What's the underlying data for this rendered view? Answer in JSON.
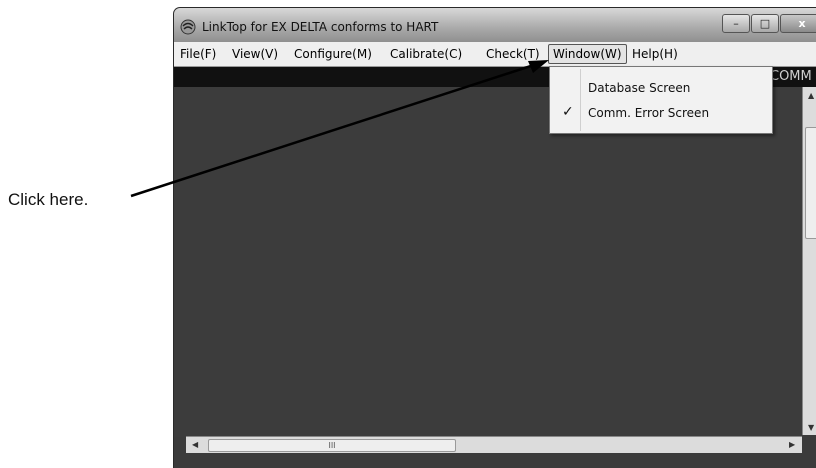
{
  "annotation": {
    "text": "Click here."
  },
  "window": {
    "title": "LinkTop for EX DELTA conforms to HART",
    "controls": {
      "minimize": "–",
      "maximize": "□",
      "close": "x"
    }
  },
  "menubar": {
    "items": [
      "File(F)",
      "View(V)",
      "Configure(M)",
      "Calibrate(C)",
      "Check(T)",
      "Window(W)",
      "Help(H)"
    ]
  },
  "status_bar": {
    "label": "COMM"
  },
  "window_menu": {
    "items": [
      {
        "label": "Database Screen",
        "checked": false
      },
      {
        "label": "Comm. Error Screen",
        "checked": true
      }
    ],
    "check_glyph": "✓"
  },
  "scrollbars": {
    "h_thumb_grip": "III"
  }
}
